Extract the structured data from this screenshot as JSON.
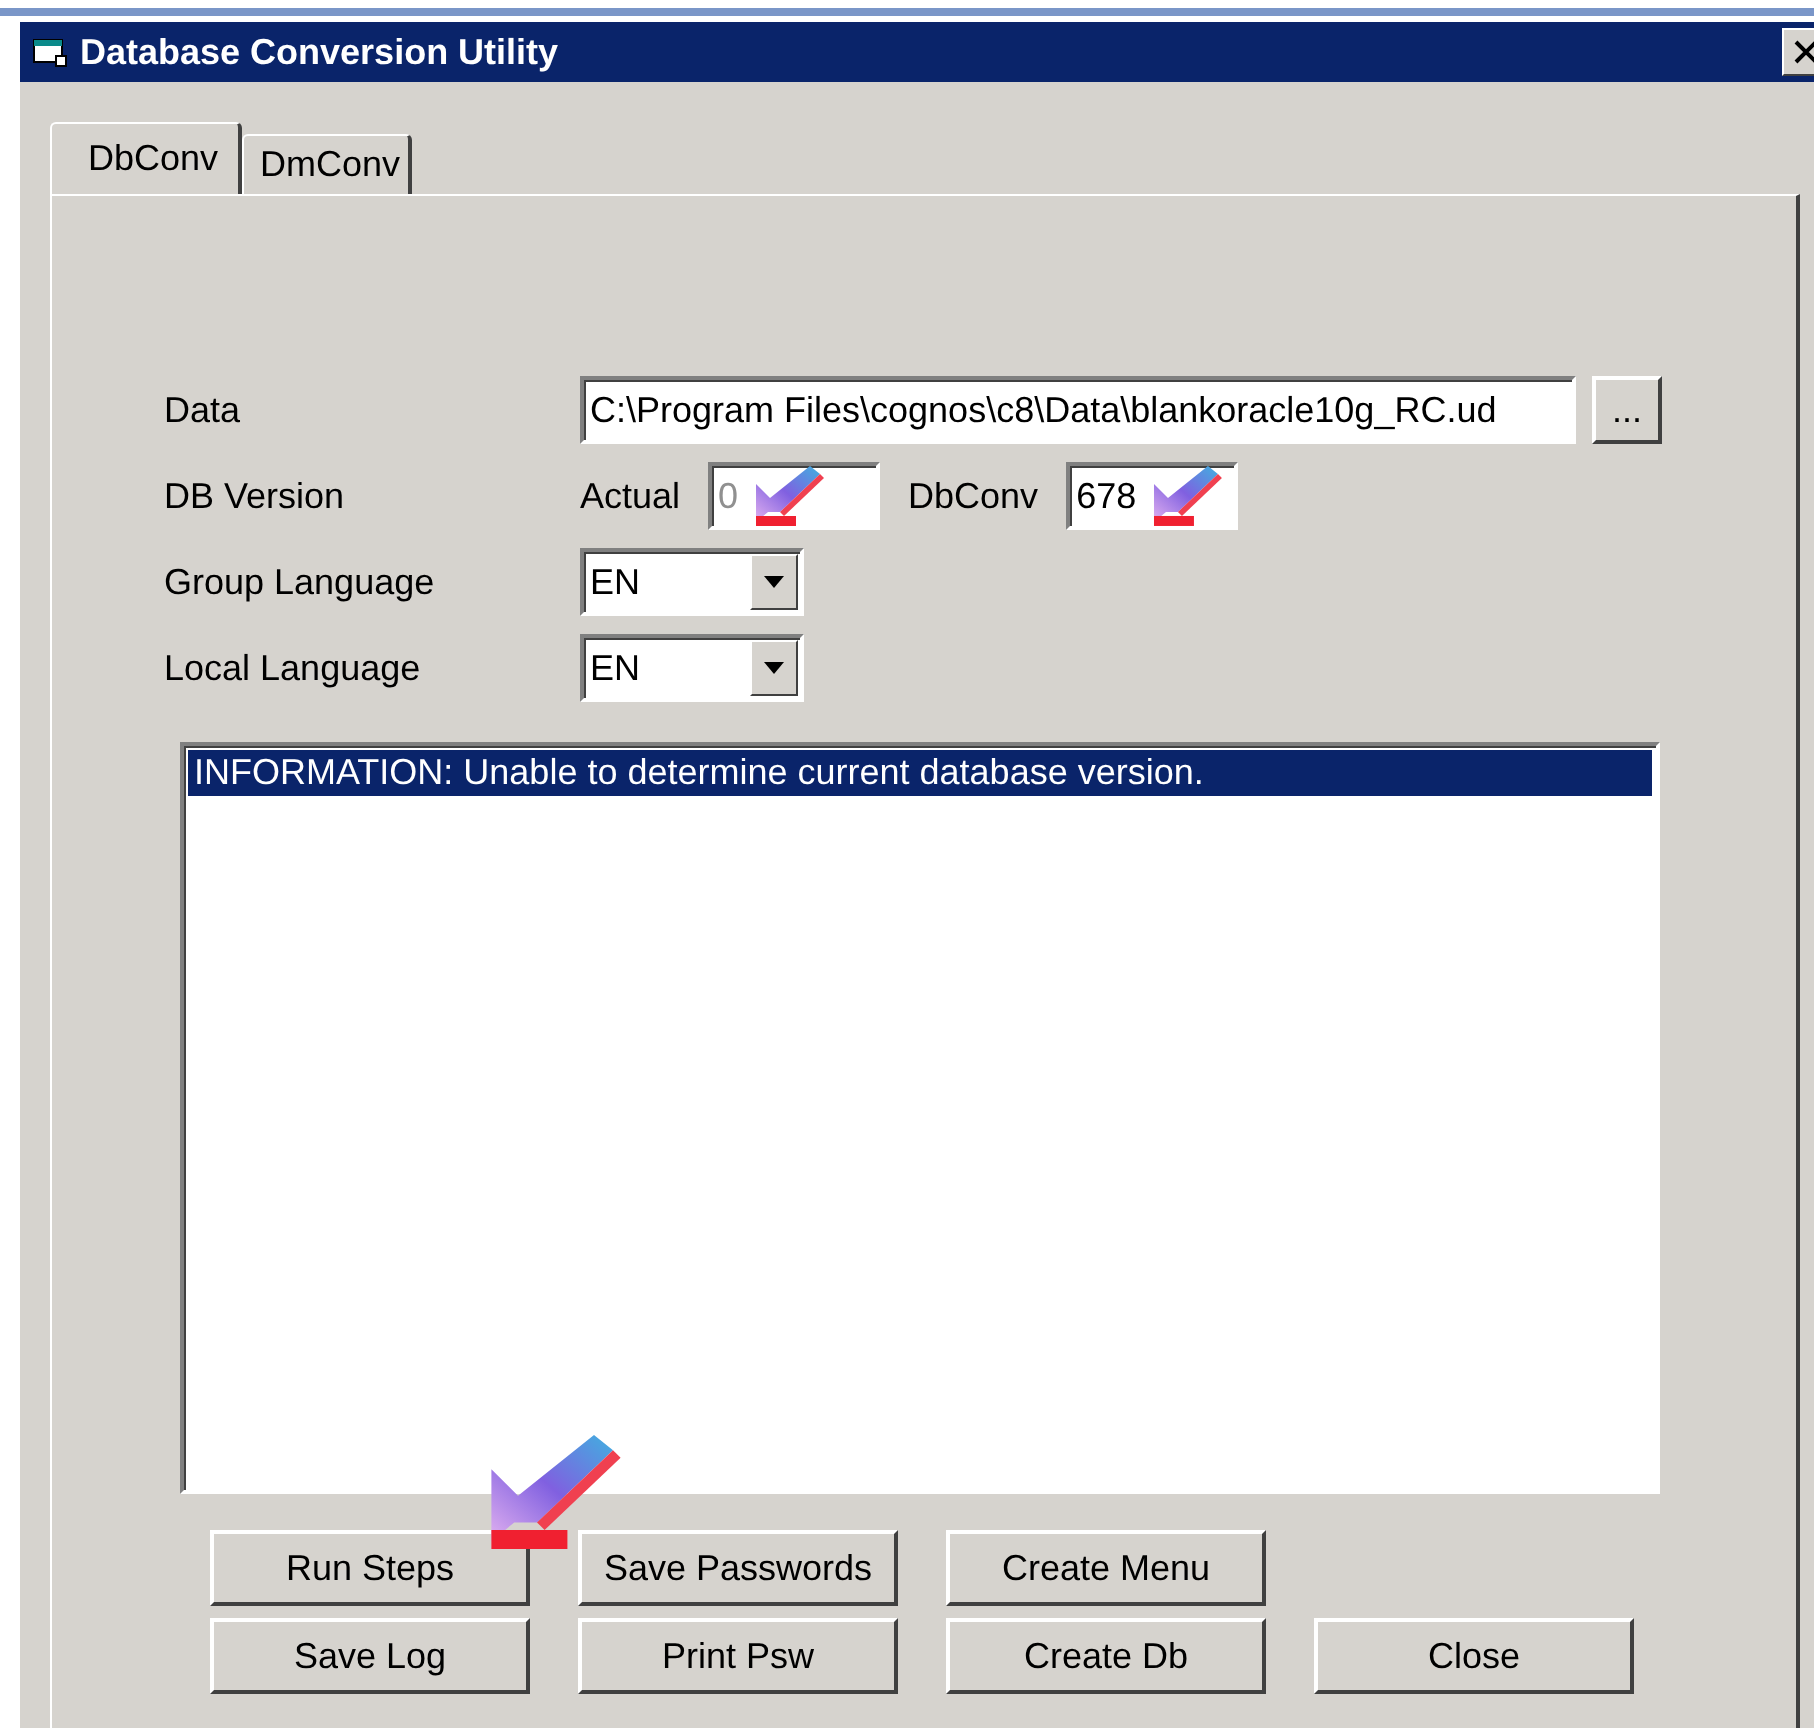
{
  "window": {
    "title": "Database Conversion Utility"
  },
  "tabs": [
    {
      "label": "DbConv",
      "selected": true
    },
    {
      "label": "DmConv",
      "selected": false
    }
  ],
  "form": {
    "data": {
      "label": "Data",
      "value": "C:\\Program Files\\cognos\\c8\\Data\\blankoracle10g_RC.ud",
      "browse": "..."
    },
    "db_version": {
      "label": "DB Version",
      "actual_label": "Actual",
      "actual_value": "0",
      "actual_disabled": true,
      "dbconv_label": "DbConv",
      "dbconv_value": "678"
    },
    "group_language": {
      "label": "Group Language",
      "value": "EN"
    },
    "local_language": {
      "label": "Local Language",
      "value": "EN"
    }
  },
  "log": [
    {
      "text": "INFORMATION:  Unable to determine current database version.",
      "selected": true
    }
  ],
  "buttons": [
    [
      "Run Steps",
      "Save Passwords",
      "Create Menu"
    ],
    [
      "Save Log",
      "Print Psw",
      "Create Db",
      "Close"
    ]
  ]
}
